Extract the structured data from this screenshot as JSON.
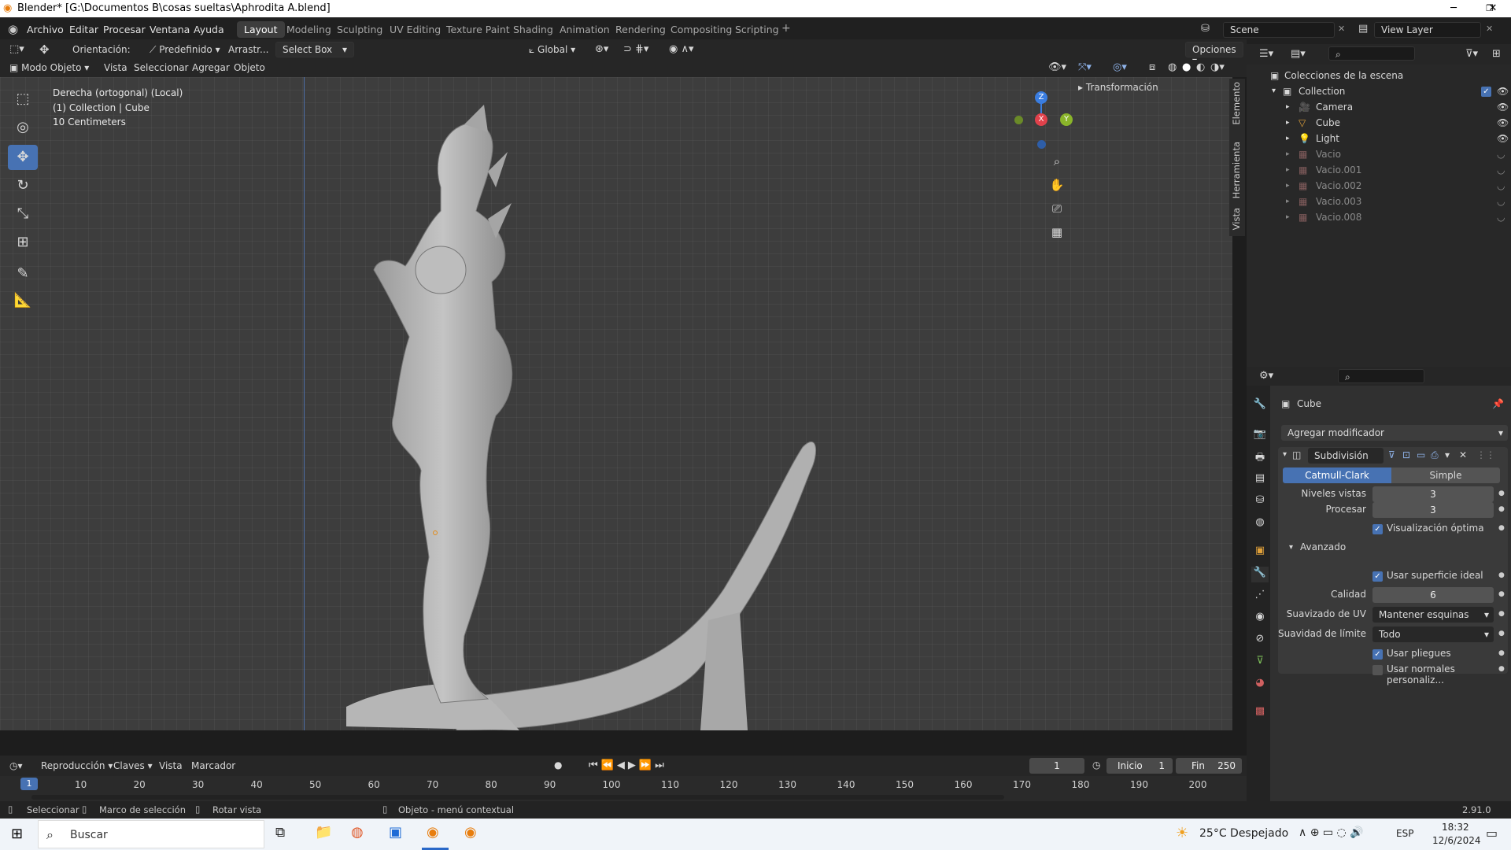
{
  "window": {
    "title": "Blender* [G:\\Documentos B\\cosas sueltas\\Aphrodita A.blend]",
    "minimize": "─",
    "maximize": "❐",
    "close": "✕"
  },
  "menu": [
    "Archivo",
    "Editar",
    "Procesar",
    "Ventana",
    "Ayuda"
  ],
  "workspaces": [
    "Layout",
    "Modeling",
    "Sculpting",
    "UV Editing",
    "Texture Paint",
    "Shading",
    "Animation",
    "Rendering",
    "Compositing",
    "Scripting"
  ],
  "add_ws": "+",
  "scene": {
    "label": "Scene",
    "view_layer": "View Layer"
  },
  "header": {
    "orientation_label": "Orientación:",
    "orientation_value": "Predefinido",
    "drag_label": "Arrastr...",
    "select_mode": "Select Box",
    "transform": "Global",
    "options": "Opciones"
  },
  "viewport_header": {
    "mode": "Modo Objeto",
    "items": [
      "Vista",
      "Seleccionar",
      "Agregar",
      "Objeto"
    ]
  },
  "viewport": {
    "info_line1": "Derecha (ortogonal) (Local)",
    "info_line2": "(1) Collection | Cube",
    "info_line3": "10 Centimeters",
    "npanel_title": "Transformación",
    "npanel_tabs": [
      "Elemento",
      "Herramienta",
      "Vista"
    ],
    "axis": {
      "z": "Z",
      "x": "X",
      "y": "Y"
    }
  },
  "outliner": {
    "root": "Colecciones de la escena",
    "collection": "Collection",
    "items": [
      {
        "name": "Camera",
        "visible": true
      },
      {
        "name": "Cube",
        "visible": true
      },
      {
        "name": "Light",
        "visible": true
      },
      {
        "name": "Vacio",
        "visible": false
      },
      {
        "name": "Vacio.001",
        "visible": false
      },
      {
        "name": "Vacio.002",
        "visible": false
      },
      {
        "name": "Vacio.003",
        "visible": false
      },
      {
        "name": "Vacio.008",
        "visible": false
      }
    ]
  },
  "properties": {
    "object": "Cube",
    "add_modifier": "Agregar modificador",
    "modifier_name": "Subdivisión",
    "tab_a": "Catmull-Clark",
    "tab_b": "Simple",
    "levels_label": "Niveles vistas",
    "levels_value": "3",
    "render_label": "Procesar",
    "render_value": "3",
    "optimal_label": "Visualización óptima",
    "advanced": "Avanzado",
    "limit_surface_label": "Usar superficie ideal",
    "quality_label": "Calidad",
    "quality_value": "6",
    "uv_smooth_label": "Suavizado de UV",
    "uv_smooth_value": "Mantener esquinas",
    "boundary_label": "Suavidad de límite",
    "boundary_value": "Todo",
    "creases_label": "Usar pliegues",
    "custom_normals_label": "Usar normales personaliz..."
  },
  "timeline": {
    "items": [
      "Reproducción",
      "Claves",
      "Vista",
      "Marcador"
    ],
    "current_frame": "1",
    "start_label": "Inicio",
    "start": "1",
    "end_label": "Fin",
    "end": "250",
    "ticks": [
      "1",
      "10",
      "20",
      "30",
      "40",
      "50",
      "60",
      "70",
      "80",
      "90",
      "100",
      "110",
      "120",
      "130",
      "140",
      "150",
      "160",
      "170",
      "180",
      "190",
      "200"
    ]
  },
  "status": {
    "select": "Seleccionar",
    "box": "Marco de selección",
    "rotate": "Rotar vista",
    "context": "Objeto - menú contextual",
    "version": "2.91.0"
  },
  "taskbar": {
    "search": "Buscar",
    "weather": "25°C Despejado",
    "lang": "ESP",
    "time": "18:32",
    "date": "12/6/2024"
  },
  "colors": {
    "accent": "#4772b3",
    "viewport": "#3d3d3d",
    "x_axis": "#e0414b",
    "y_axis": "#8ab52a",
    "z_axis": "#3a7de0"
  }
}
